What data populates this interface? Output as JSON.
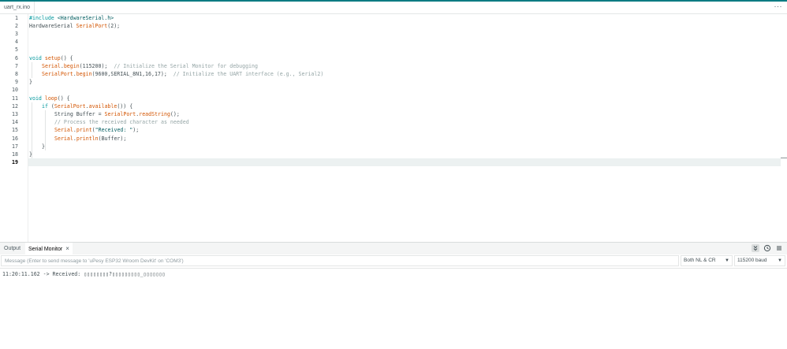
{
  "tabs": {
    "file": "uart_rx.ino",
    "more": "···"
  },
  "editor": {
    "line_numbers": [
      "1",
      "2",
      "3",
      "4",
      "5",
      "6",
      "7",
      "8",
      "9",
      "10",
      "11",
      "12",
      "13",
      "14",
      "15",
      "16",
      "17",
      "18",
      "19"
    ],
    "lines": {
      "l1": {
        "a": "#include ",
        "b": "<HardwareSerial.h>"
      },
      "l2": {
        "a": "HardwareSerial ",
        "b": "SerialPort",
        "c": "(2);"
      },
      "l6": {
        "a": "void ",
        "b": "setup",
        "c": "() {"
      },
      "l7": {
        "a": "Serial",
        "b": ".",
        "c": "begin",
        "d": "(115200);  ",
        "e": "// Initialize the Serial Monitor for debugging"
      },
      "l8": {
        "a": "SerialPort",
        "b": ".",
        "c": "begin",
        "d": "(9600,SERIAL_8N1,16,17);  ",
        "e": "// Initialize the UART interface (e.g., Serial2)"
      },
      "l9": "}",
      "l11": {
        "a": "void ",
        "b": "loop",
        "c": "() {"
      },
      "l12": {
        "a": "if ",
        "b": "(",
        "c": "SerialPort",
        "d": ".",
        "e": "available",
        "f": "()) {"
      },
      "l13": {
        "a": "String Buffer = ",
        "b": "SerialPort",
        "c": ".",
        "d": "readString",
        "e": "();"
      },
      "l14": "// Process the received character as needed",
      "l15": {
        "a": "Serial",
        "b": ".",
        "c": "print",
        "d": "(",
        "e": "\"Received: \"",
        "f": ");"
      },
      "l16": {
        "a": "Serial",
        "b": ".",
        "c": "println",
        "d": "(Buffer);"
      },
      "l17": "}",
      "l18": "}"
    }
  },
  "panel": {
    "tab_output": "Output",
    "tab_serial": "Serial Monitor",
    "close": "×",
    "message_placeholder": "Message (Enter to send message to 'uPesy ESP32 Wroom DevKit' on 'COM3')",
    "line_ending": "Both NL & CR",
    "baud": "115200 baud",
    "icons": [
      "chevrons-down-icon",
      "clock-icon",
      "list-icon"
    ],
    "output_line": "11:20:11.162 -> Received: ▯▯▯▯▯▯▯▯?▯▯▯▯▯▯▯▯▯_▯▯▯▯▯▯▯"
  },
  "colors": {
    "accent": "#0a7b83",
    "keyword": "#00979c",
    "function": "#d35400",
    "comment": "#95a5a6"
  }
}
